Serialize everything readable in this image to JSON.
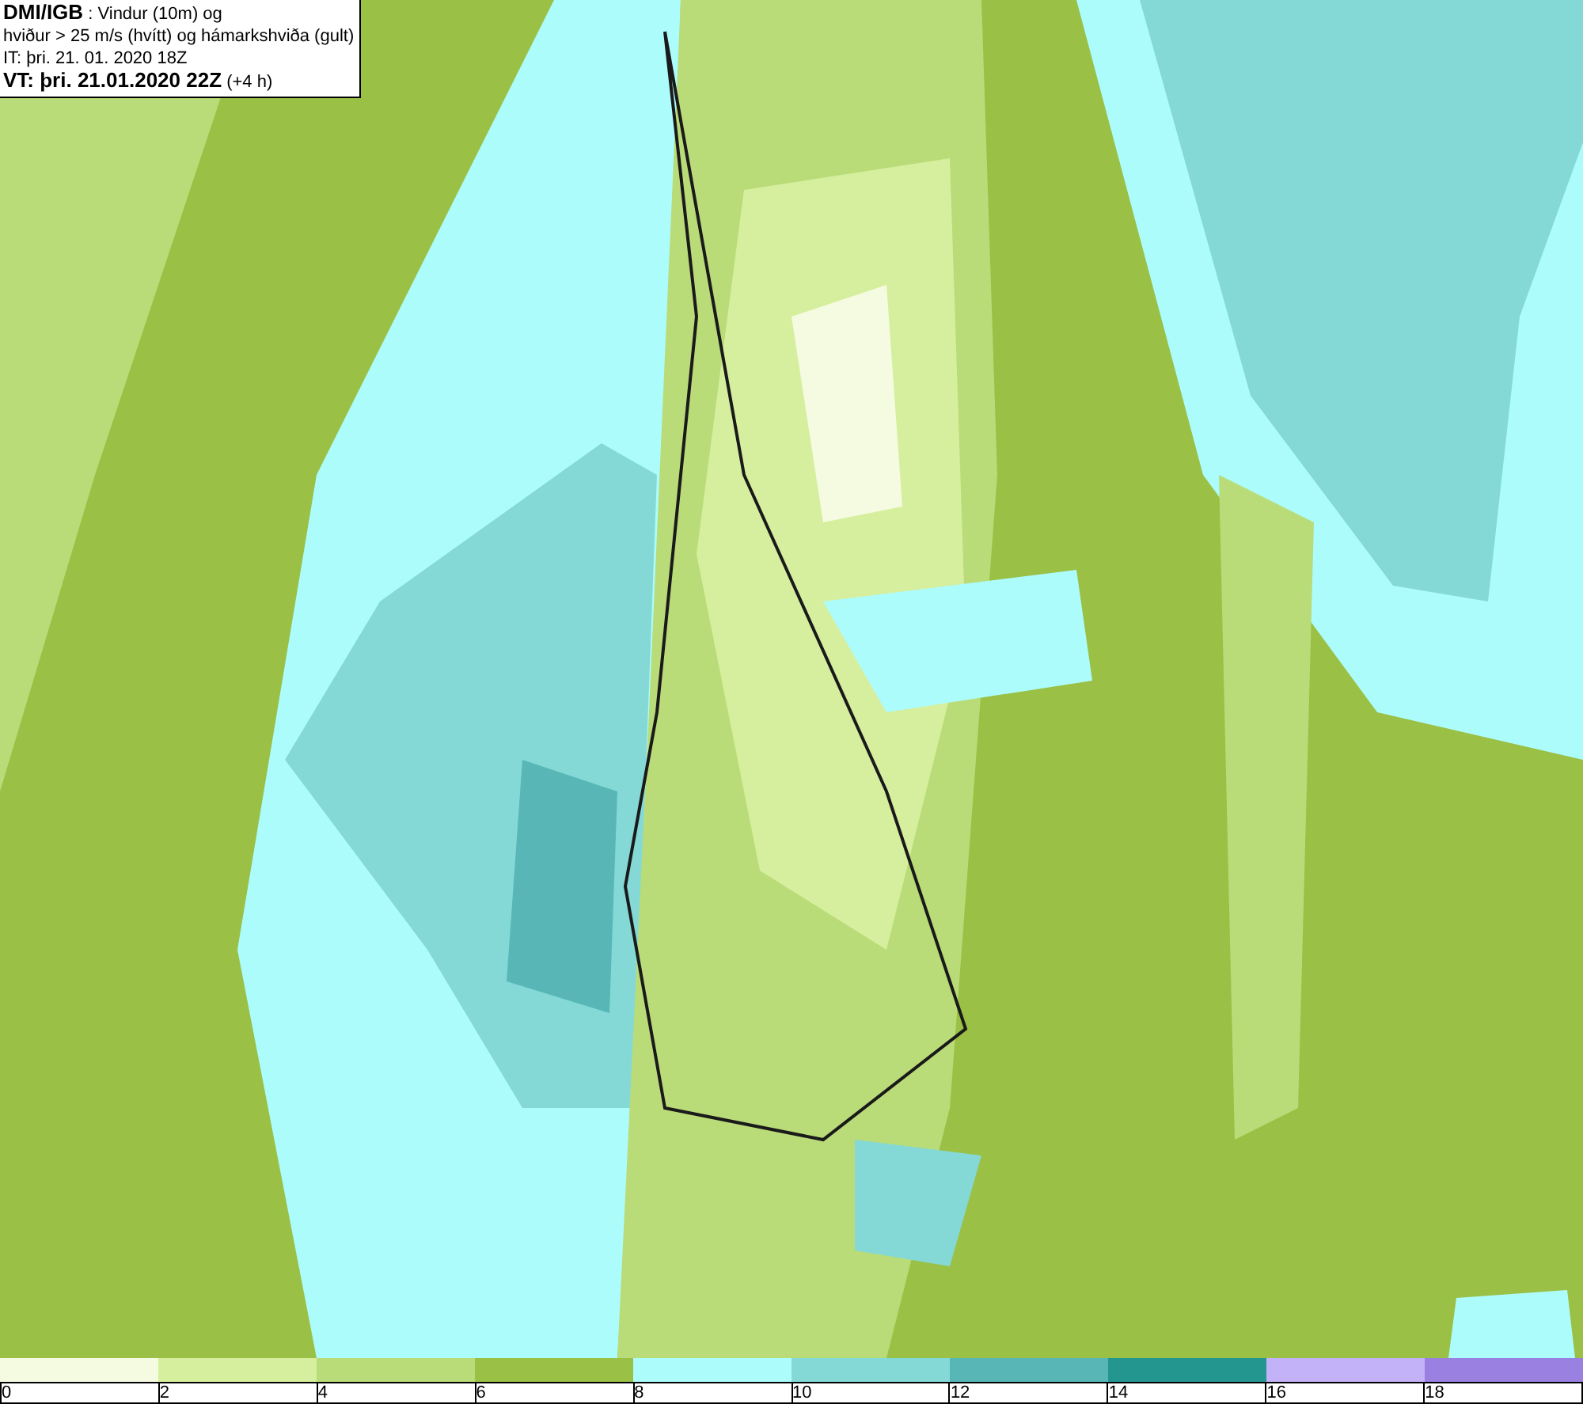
{
  "title_box": {
    "lines": [
      "**DMI/IGB** : Vindur (10m) og",
      "hviður > 25 m/s (hvítt) og hámarkshviða (gult)",
      "IT: þri. 21. 01. 2020 18Z",
      "**VT: þri. 21.01.2020 22Z** (+4 h)"
    ]
  },
  "legend": {
    "bins": [
      {
        "color": "#f4fbe0"
      },
      {
        "color": "#d6ef9e"
      },
      {
        "color": "#b9dc78"
      },
      {
        "color": "#9bc046"
      },
      {
        "color": "#adfcfc"
      },
      {
        "color": "#84d9d6"
      },
      {
        "color": "#58b7b6"
      },
      {
        "color": "#249690"
      },
      {
        "color": "#c3b2f8"
      },
      {
        "color": "#9a80e0"
      }
    ],
    "ticks": [
      "0",
      "2",
      "4",
      "6",
      "8",
      "10",
      "12",
      "14",
      "16",
      "18"
    ]
  }
}
